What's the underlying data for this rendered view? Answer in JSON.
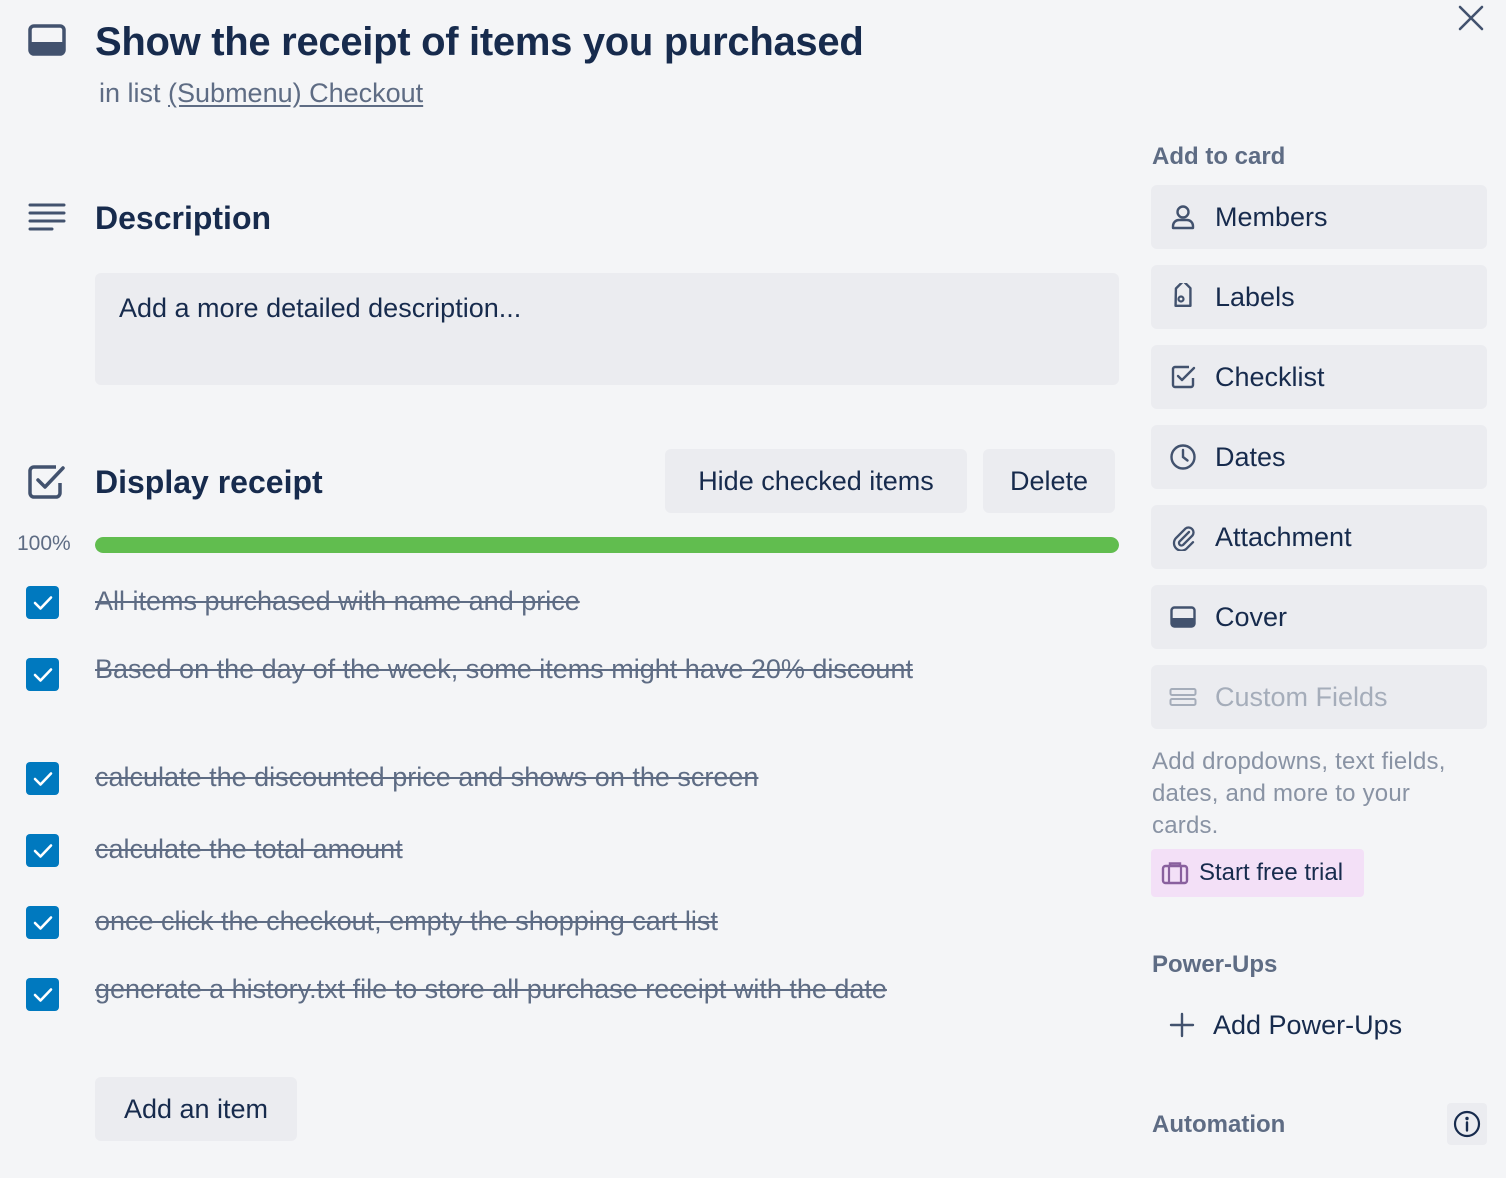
{
  "card": {
    "title": "Show the receipt of items you purchased",
    "list_prefix": "in list",
    "list_name": "(Submenu) Checkout"
  },
  "description": {
    "heading": "Description",
    "placeholder": "Add a more detailed description..."
  },
  "checklist": {
    "title": "Display receipt",
    "hide_checked_label": "Hide checked items",
    "delete_label": "Delete",
    "progress_label": "100%",
    "progress_fraction": 1.0,
    "progress_color": "#61bd4f",
    "checkbox_color": "#0079bf",
    "items": [
      {
        "text": "All items purchased with name and price",
        "checked": true
      },
      {
        "text": "Based on the day of the week, some items might have 20% discount",
        "checked": true
      },
      {
        "text": "calculate the discounted price and shows on the screen",
        "checked": true
      },
      {
        "text": "calculate the total amount",
        "checked": true
      },
      {
        "text": "once click the checkout, empty the shopping cart list",
        "checked": true
      },
      {
        "text": "generate a history.txt file to store all purchase receipt with the date",
        "checked": true
      }
    ],
    "add_item_label": "Add an item"
  },
  "sidebar": {
    "add_to_card_heading": "Add to card",
    "buttons": [
      {
        "label": "Members",
        "icon": "person-icon"
      },
      {
        "label": "Labels",
        "icon": "tag-icon"
      },
      {
        "label": "Checklist",
        "icon": "checkbox-icon"
      },
      {
        "label": "Dates",
        "icon": "clock-icon"
      },
      {
        "label": "Attachment",
        "icon": "paperclip-icon"
      },
      {
        "label": "Cover",
        "icon": "card-cover-icon"
      },
      {
        "label": "Custom Fields",
        "icon": "custom-fields-icon",
        "disabled": true
      }
    ],
    "custom_fields_description": "Add dropdowns, text fields, dates, and more to your cards.",
    "start_trial_label": "Start free trial",
    "powerups_heading": "Power-Ups",
    "add_powerups_label": "Add Power-Ups",
    "automation_heading": "Automation"
  }
}
